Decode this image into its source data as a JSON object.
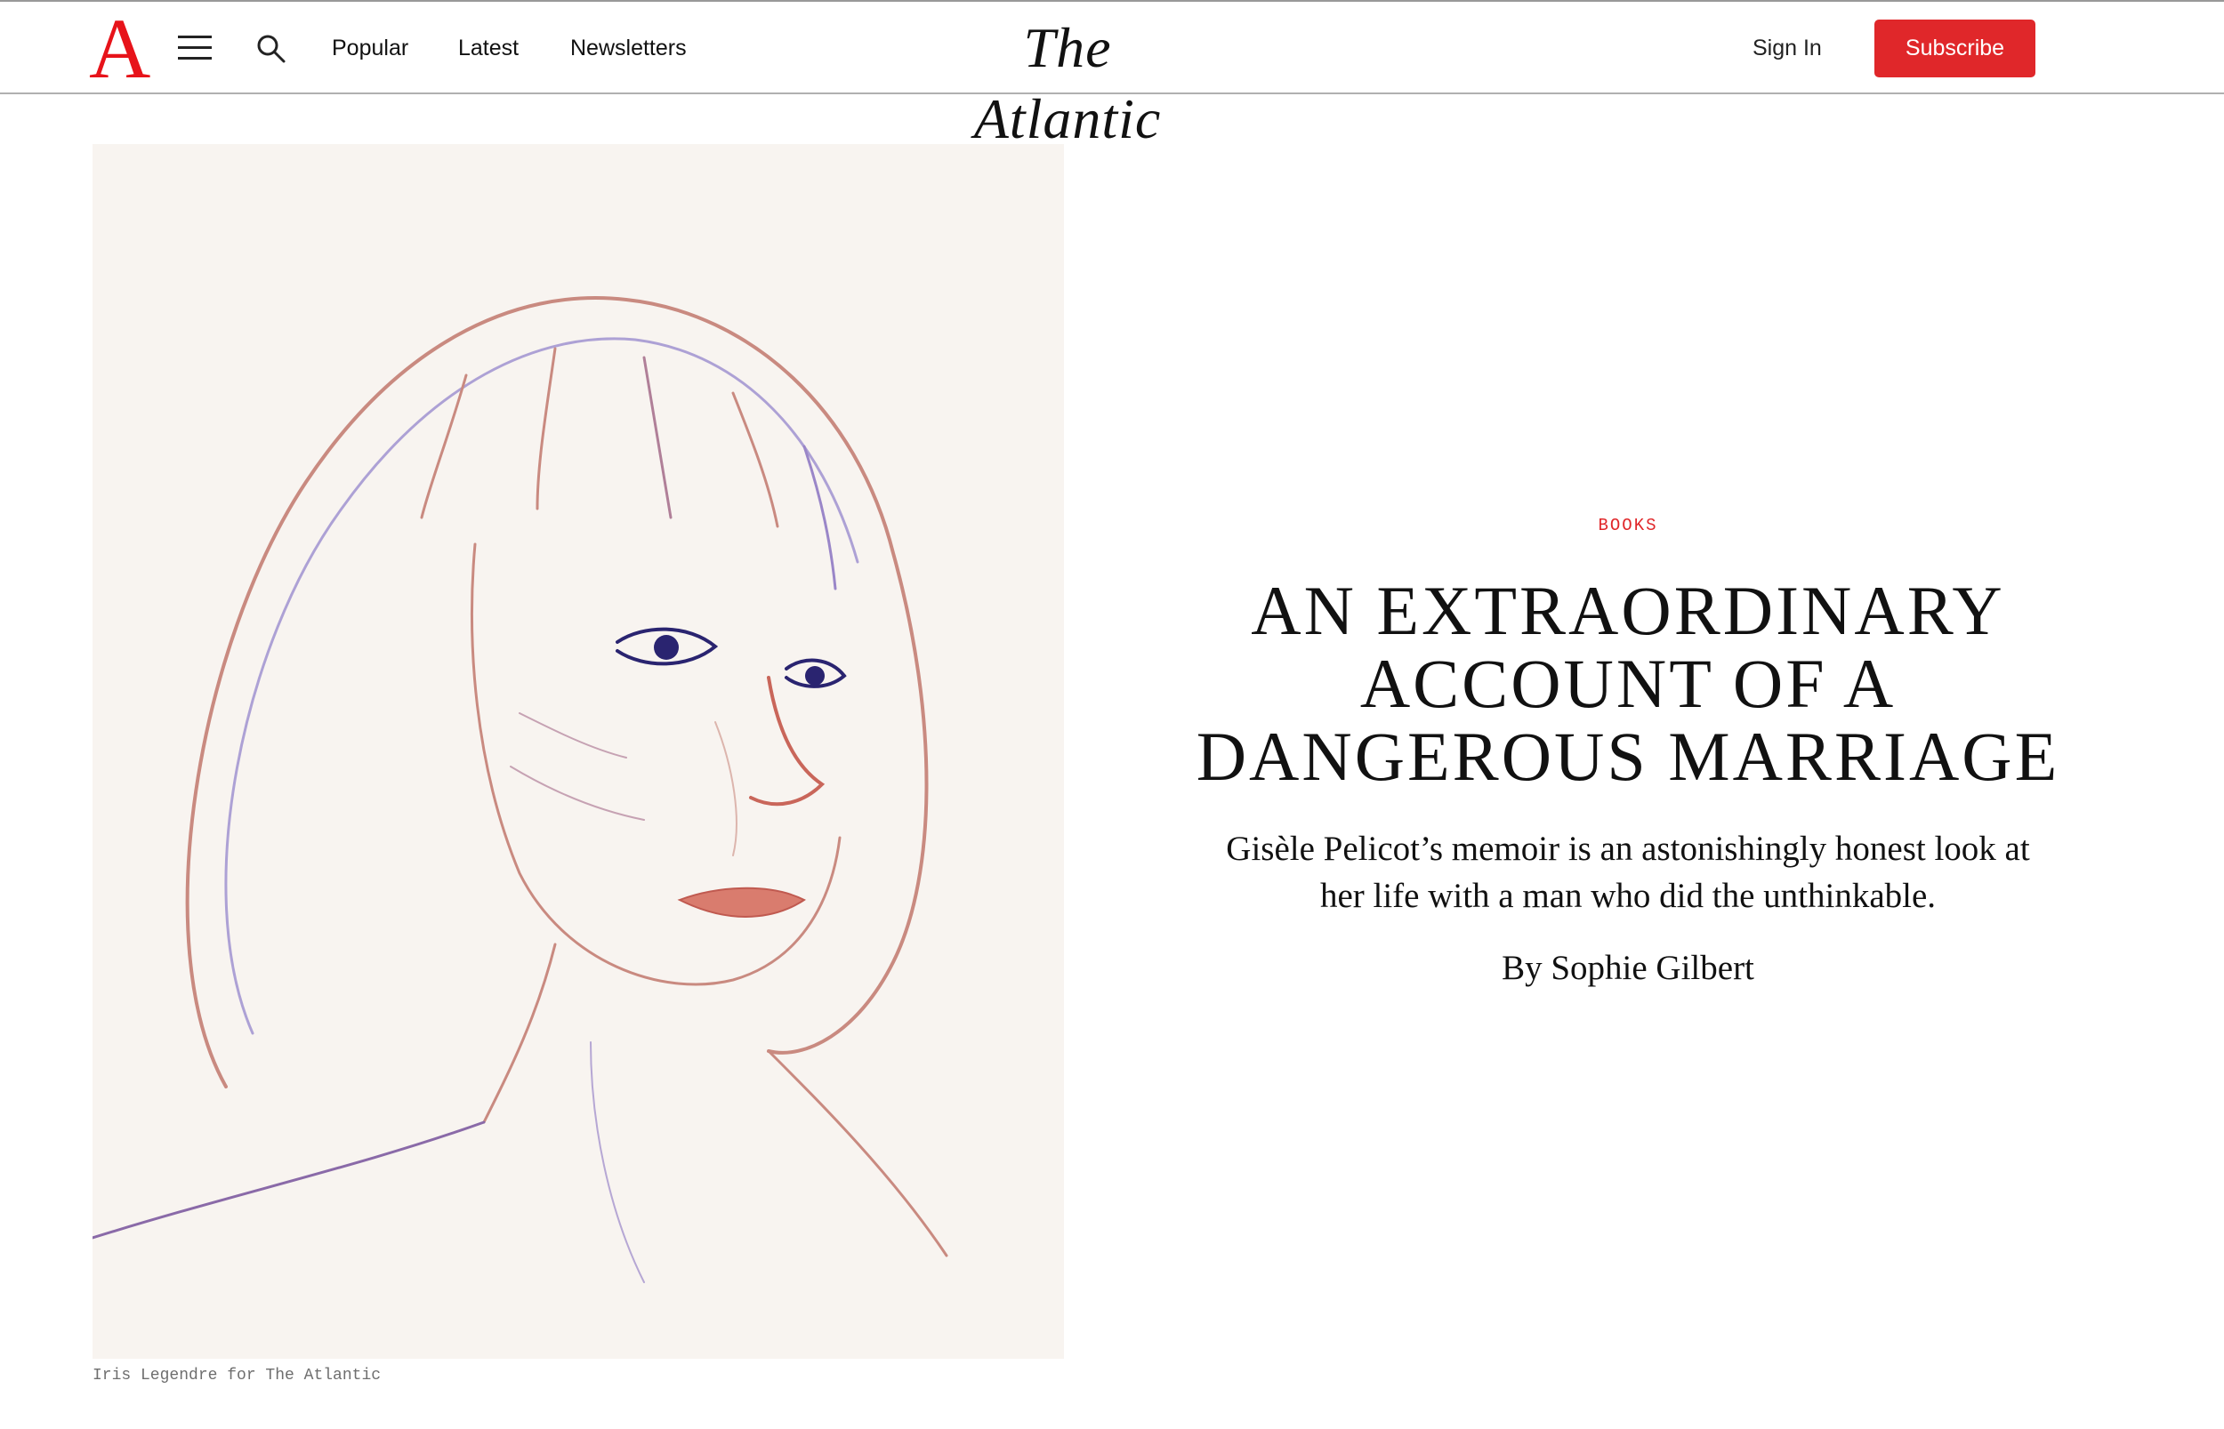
{
  "header": {
    "logo_letter": "A",
    "nav": [
      "Popular",
      "Latest",
      "Newsletters"
    ],
    "wordmark": "The Atlantic",
    "sign_in": "Sign In",
    "subscribe": "Subscribe",
    "accent_color": "#e0272a"
  },
  "icons": {
    "menu": "hamburger-menu-icon",
    "search": "search-icon"
  },
  "hero": {
    "image_credit": "Iris Legendre for The Atlantic"
  },
  "article": {
    "section": "BOOKS",
    "headline_lines": [
      "AN EXTRAORDINARY",
      "ACCOUNT OF A",
      "DANGEROUS MARRIAGE"
    ],
    "dek_lines": [
      "Gisèle Pelicot’s memoir is an astonishingly honest look at",
      "her life with a man who did the unthinkable."
    ],
    "byline_prefix": "By",
    "author": "Sophie Gilbert"
  }
}
